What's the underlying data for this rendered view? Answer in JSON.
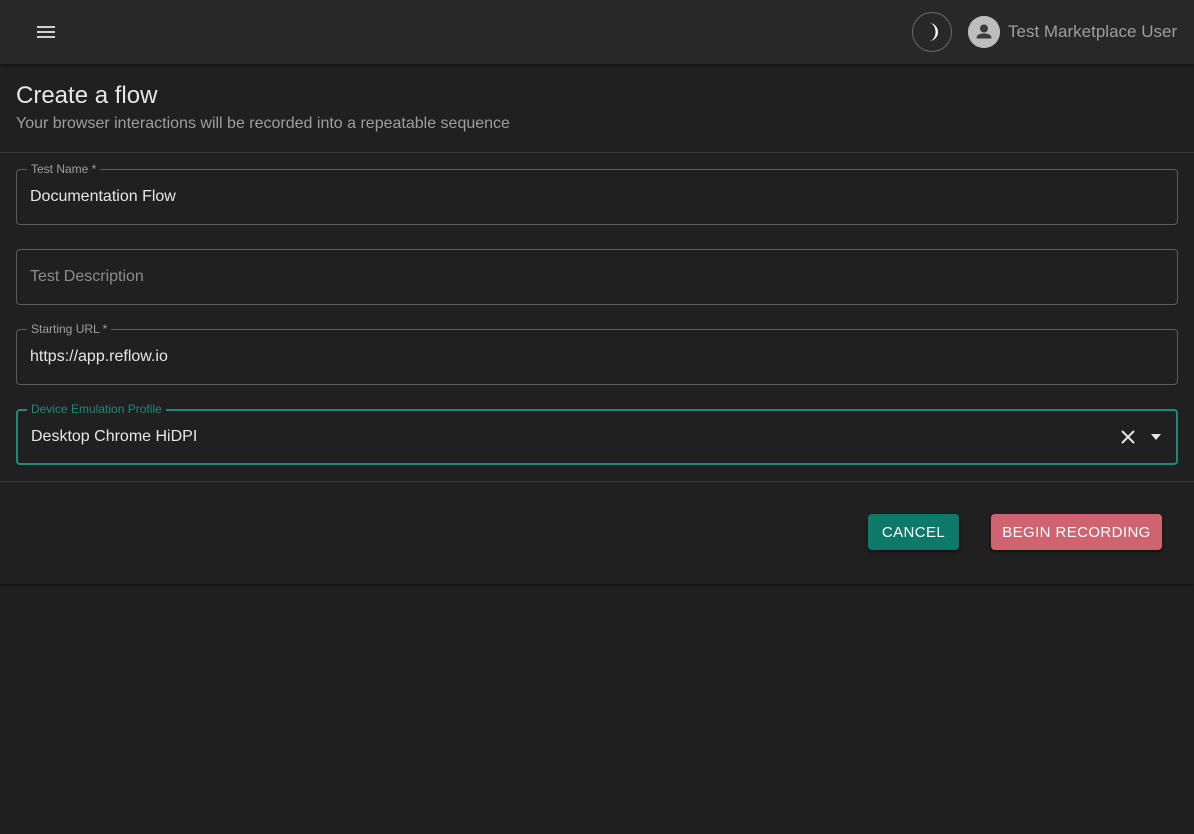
{
  "appbar": {
    "menu_icon": "hamburger-menu-icon",
    "theme_icon": "moon-icon",
    "avatar_icon": "person-icon",
    "user_name": "Test Marketplace User"
  },
  "page": {
    "title": "Create a flow",
    "subtitle": "Your browser interactions will be recorded into a repeatable sequence"
  },
  "form": {
    "test_name": {
      "label": "Test Name *",
      "value": "Documentation Flow"
    },
    "test_description": {
      "placeholder": "Test Description",
      "value": ""
    },
    "starting_url": {
      "label": "Starting URL *",
      "value": "https://app.reflow.io"
    },
    "device_profile": {
      "label": "Device Emulation Profile",
      "value": "Desktop Chrome HiDPI",
      "clear_icon": "close-icon",
      "dropdown_icon": "arrow-drop-down-icon"
    }
  },
  "actions": {
    "cancel_label": "CANCEL",
    "begin_label": "BEGIN RECORDING"
  },
  "colors": {
    "accent": "#1d8a7a",
    "cancel_bg": "#0d7a69",
    "record_bg": "#cf6470",
    "background": "#1f1f1f",
    "appbar": "#282828"
  }
}
